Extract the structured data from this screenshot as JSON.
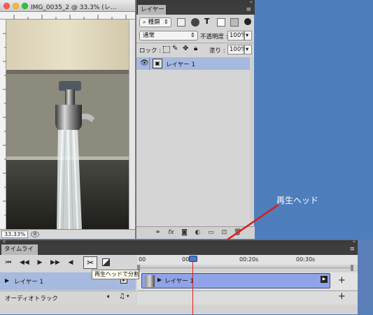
{
  "document": {
    "title": "IMG_0035_2 @ 33.3% (レ…",
    "zoom": "33.33%"
  },
  "layers": {
    "tab_label": "レイヤー",
    "filter_label": "種類",
    "blend_mode": "通常",
    "opacity_label": "不透明度 :",
    "opacity_value": "100%",
    "lock_label": "ロック :",
    "fill_label": "塗り :",
    "fill_value": "100%",
    "layer_name": "レイヤー 1"
  },
  "timeline": {
    "tab_label": "タイムライン",
    "time_labels": [
      "00",
      "00:",
      "00:20s",
      "00:30s"
    ],
    "track1_label": "レイヤー 1",
    "track2_label": "オーディオトラック",
    "clip_label": "レイヤー 1",
    "tooltip": "再生ヘッドで分割"
  },
  "annotation": "再生ヘッド",
  "colors": {
    "desktop": "#4f7ebd",
    "selected_row": "#a6b9df",
    "clip": "#8fa3e6",
    "playhead": "#e02020"
  }
}
